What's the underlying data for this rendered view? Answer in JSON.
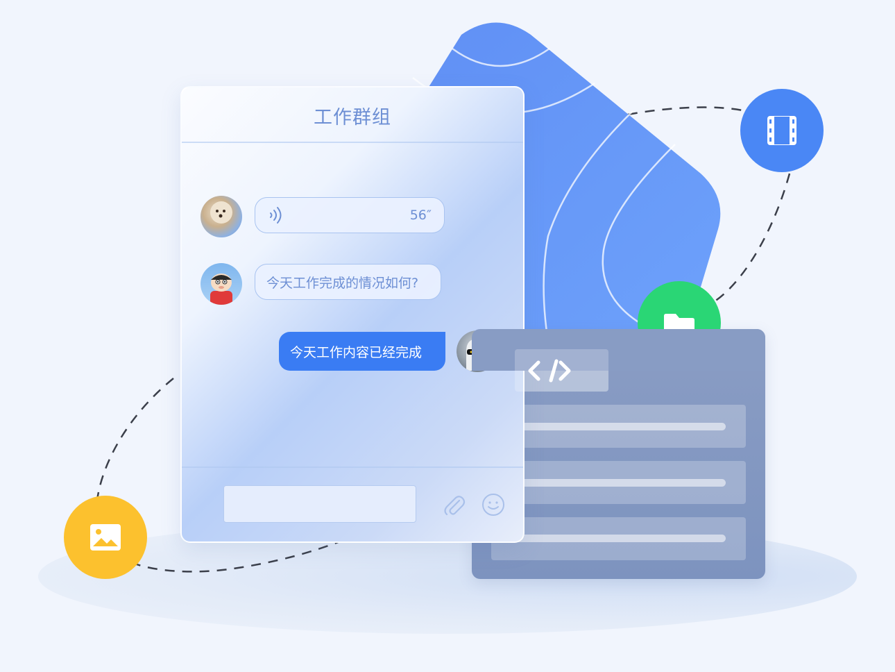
{
  "chat": {
    "title": "工作群组",
    "messages": [
      {
        "type": "voice",
        "direction": "incoming",
        "duration": "56″"
      },
      {
        "type": "text",
        "direction": "incoming",
        "text": "今天工作完成的情况如何?"
      },
      {
        "type": "text",
        "direction": "outgoing",
        "text": "今天工作内容已经完成"
      }
    ],
    "input": {
      "value": ""
    },
    "icons": [
      "attachment-icon",
      "emoji-icon"
    ]
  },
  "decor": {
    "code_panel": {
      "icon": "code-icon",
      "rows": 3
    },
    "badges": [
      {
        "icon": "film-icon",
        "color": "#4a87f5"
      },
      {
        "icon": "folder-icon",
        "color": "#2ad675"
      },
      {
        "icon": "image-icon",
        "color": "#fcc12e"
      }
    ],
    "shape_color": "#5b8ff5"
  },
  "colors": {
    "accent": "#3a7cf3",
    "background": "#f1f5fd",
    "title": "#6d8fd4"
  }
}
